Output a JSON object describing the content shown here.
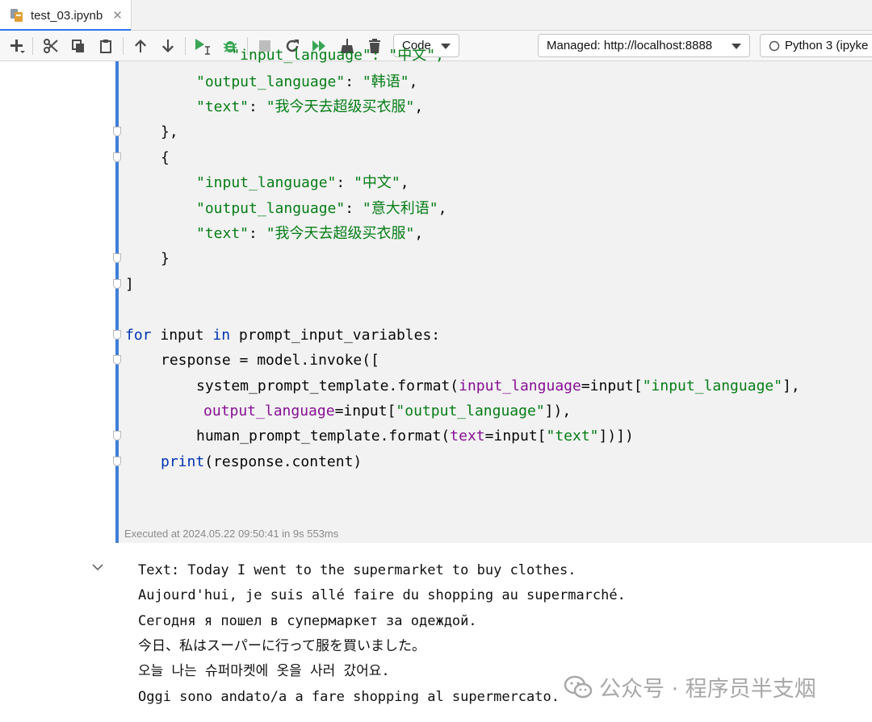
{
  "tab": {
    "filename": "test_03.ipynb",
    "close": "✕"
  },
  "toolbar": {
    "cell_type": "Code",
    "server": "Managed: http://localhost:8888",
    "kernel": "Python 3 (ipyke"
  },
  "code_lines": [
    "    \"input_language\": \"中文\",",
    "    \"output_language\": \"韩语\",",
    "    \"text\": \"我今天去超级买衣服\","
  ],
  "code": {
    "l2_key": "\"output_language\"",
    "l2_val": "\"韩语\"",
    "l3_key": "\"text\"",
    "l3_val": "\"我今天去超级买衣服\"",
    "l4": "},",
    "l5": "{",
    "l6_key": "\"input_language\"",
    "l6_val": "\"中文\"",
    "l7_key": "\"output_language\"",
    "l7_val": "\"意大利语\"",
    "l8_key": "\"text\"",
    "l8_val": "\"我今天去超级买衣服\"",
    "l9": "}",
    "l10": "]",
    "l12_for": "for",
    "l12_input": " input ",
    "l12_in": "in",
    "l12_rest": " prompt_input_variables:",
    "l13": "response = model.invoke([",
    "l14_a": "system_prompt_template.format(",
    "l14_p": "input_language",
    "l14_b": "=input[",
    "l14_s": "\"input_language\"",
    "l14_c": "],",
    "l15_p": "output_language",
    "l15_b": "=input[",
    "l15_s": "\"output_language\"",
    "l15_c": "]),",
    "l16_a": "human_prompt_template.format(",
    "l16_p": "text",
    "l16_b": "=input[",
    "l16_s": "\"text\"",
    "l16_c": "])])",
    "l17_print": "print",
    "l17_rest": "(response.content)"
  },
  "execution": "Executed at 2024.05.22 09:50:41 in 9s 553ms",
  "output_lines": [
    "Text: Today I went to the supermarket to buy clothes.",
    "Aujourd'hui, je suis allé faire du shopping au supermarché.",
    "Сегодня я пошел в супермаркет за одеждой.",
    "今日、私はスーパーに行って服を買いました。",
    "오늘 나는 슈퍼마켓에 옷을 사러 갔어요.",
    "Oggi sono andato/a a fare shopping al supermercato."
  ],
  "watermark": "公众号 · 程序员半支烟",
  "colors": {
    "accent": "#3574f0",
    "cell_bar": "#3f7fd9",
    "keyword": "#0033b3",
    "string": "#067d17",
    "param": "#871094",
    "run": "#3aa655"
  }
}
